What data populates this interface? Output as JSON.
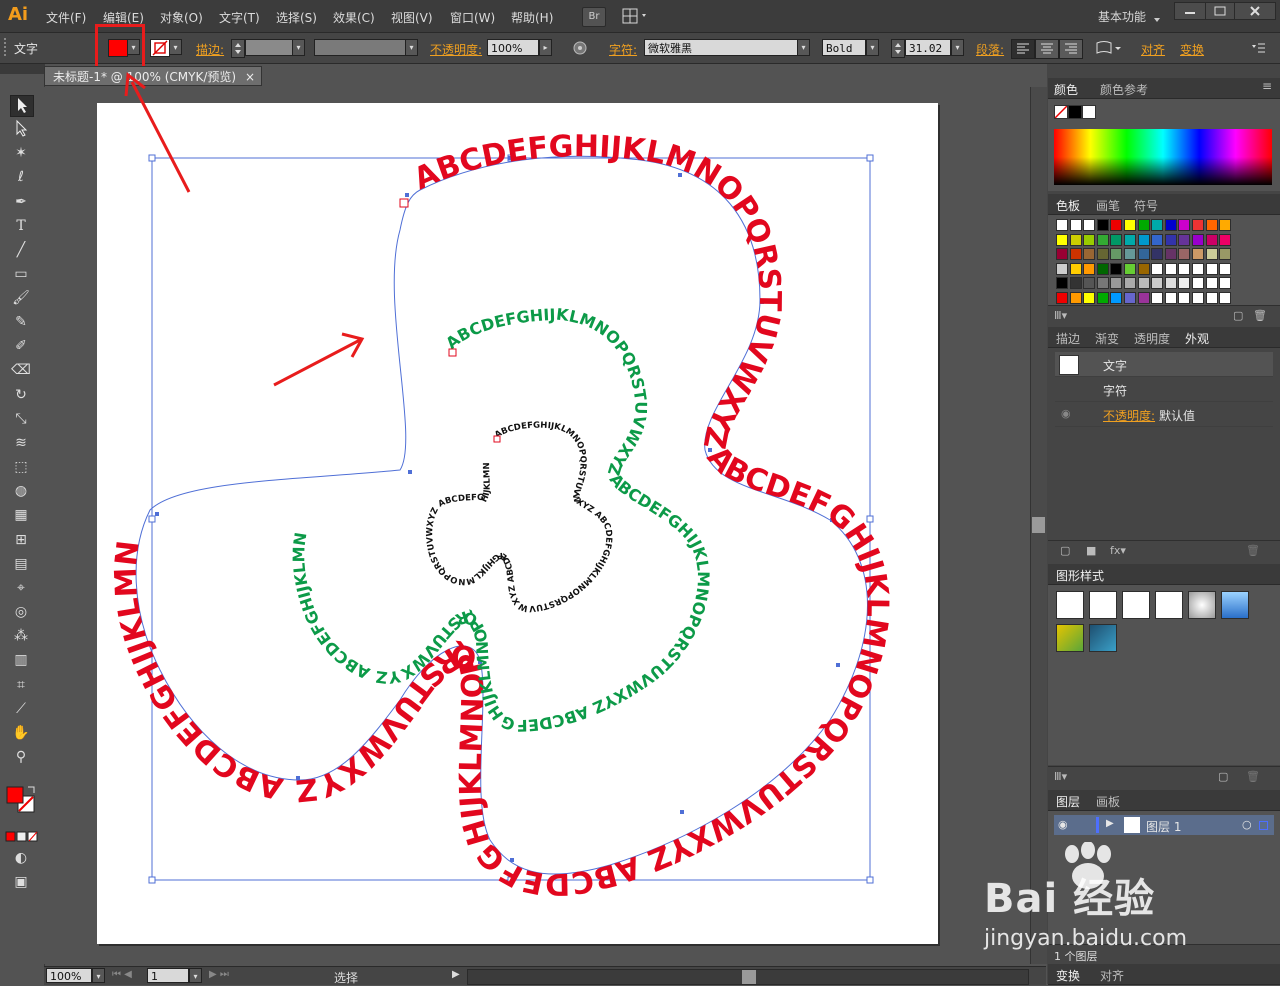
{
  "app": {
    "logo": "Ai"
  },
  "menu": [
    "文件(F)",
    "编辑(E)",
    "对象(O)",
    "文字(T)",
    "选择(S)",
    "效果(C)",
    "视图(V)",
    "窗口(W)",
    "帮助(H)"
  ],
  "menubar_right": {
    "bridge": "Br",
    "workspace": "基本功能"
  },
  "control_bar": {
    "tool_label": "文字",
    "fill_color": "#ff0000",
    "stroke_label": "描边:",
    "opacity_label": "不透明度:",
    "opacity_value": "100%",
    "char_label": "字符:",
    "font_family": "微软雅黑",
    "font_style": "Bold",
    "font_size": "31.02",
    "paragraph_label": "段落:",
    "align_label": "对齐",
    "transform_label": "变换"
  },
  "document_tab": {
    "title": "未标题-1* @ 100% (CMYK/预览)",
    "close": "×"
  },
  "art": {
    "red_text": "ABCDEFGHIJKLMNOPQRSTUVWXYZ ABCDEFGHIJKLMNOPQRSTUVWXYZ ABCDEFGHIJKLMNOPQRSTUVWXYZ ABCDEFGHIJKLMN",
    "green_text": "ABCDEFGHIJKLMNOPQRSTUVWXYZ ABCDEFGHIJKLMNOPQRSTUVWXYZ ABCDEFGHIJKLMNOPQRSTUVWXYZ ABCDEFGHIJKLMN",
    "black_text": "ABCDEFGHIJKLMNOPQRSTUVWXYZ ABCDEFGHIJKLMNOPQRSTUVWXYZ ABCDEFGHIJKLMNOPQRSTUVWXYZ ABCDEFGHIJKLMN",
    "colors": {
      "red": "#e2071e",
      "green": "#0c9a48",
      "black": "#111111",
      "annotation": "#e81c1c",
      "selection": "#4f6fd6"
    }
  },
  "statusbar": {
    "zoom": "100%",
    "page": "1",
    "tool_status": "选择"
  },
  "panels": {
    "color": {
      "tabs": [
        "颜色",
        "颜色参考"
      ]
    },
    "swatches": {
      "tabs": [
        "色板",
        "画笔",
        "符号"
      ]
    },
    "appearance": {
      "tabs": [
        "描边",
        "渐变",
        "透明度",
        "外观"
      ],
      "rows": [
        {
          "label": "文字"
        },
        {
          "label": "字符"
        },
        {
          "label": "不透明度:",
          "value": "默认值"
        }
      ]
    },
    "graphic_styles": {
      "tabs": [
        "图形样式"
      ]
    },
    "layers": {
      "tabs": [
        "图层",
        "画板"
      ],
      "layer_name": "图层 1",
      "count": "1 个图层"
    },
    "bottom": {
      "tabs": [
        "变换",
        "对齐"
      ]
    }
  },
  "watermark": {
    "brand": "Bai  经验",
    "url": "jingyan.baidu.com"
  }
}
